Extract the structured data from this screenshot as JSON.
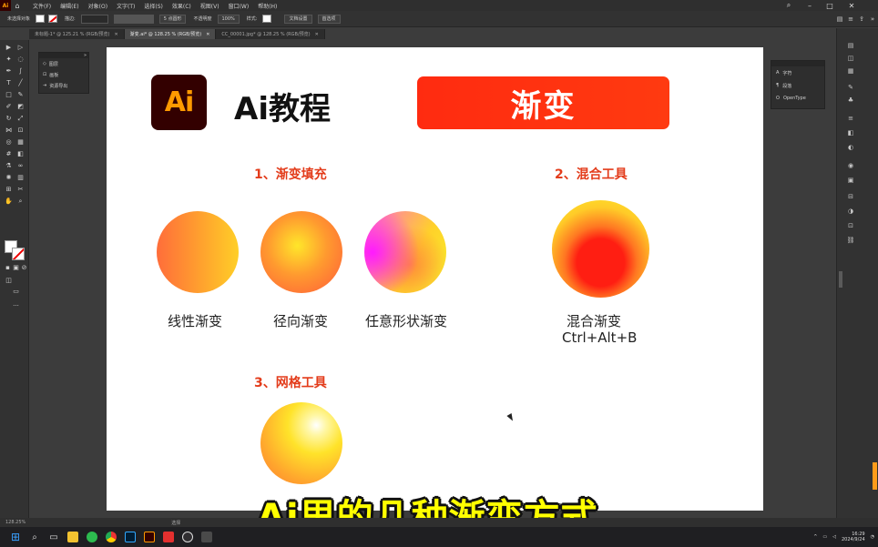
{
  "app": {
    "logo": "Ai",
    "menu": [
      "文件(F)",
      "编辑(E)",
      "对象(O)",
      "文字(T)",
      "选择(S)",
      "效果(C)",
      "视图(V)",
      "窗口(W)",
      "帮助(H)"
    ]
  },
  "control_bar": {
    "selection_label": "未选择对象",
    "stroke_label": "描边:",
    "brush_label": "5 点圆形",
    "opacity_label": "不透明度",
    "opacity_value": "100%",
    "style_label": "样式:",
    "doc_setup_button": "文档设置",
    "preferences_button": "首选项"
  },
  "tabs": [
    {
      "label": "未标题-1* @ 125.21 % (RGB/预览)",
      "active": false
    },
    {
      "label": "渐变.ai* @ 128.25 % (RGB/预览)",
      "active": true
    },
    {
      "label": "CC_00001.jpg* @ 128.25 % (RGB/预览)",
      "active": false
    }
  ],
  "layers_panel": {
    "rows": [
      "图层",
      "画板",
      "资源导出"
    ]
  },
  "char_panel": {
    "rows": [
      "字符",
      "段落",
      "OpenType"
    ]
  },
  "artboard": {
    "logo_text": "Ai",
    "heading": "Ai教程",
    "banner": "渐变",
    "sections": {
      "gradient_fill": "1、渐变填充",
      "blend_tool": "2、混合工具",
      "mesh_tool": "3、网格工具"
    },
    "captions": {
      "linear": "线性渐变",
      "radial": "径向渐变",
      "freeform": "任意形状渐变",
      "blend": "混合渐变",
      "blend_shortcut": "Ctrl+Alt+B"
    }
  },
  "subtitle": "Ai里的几种渐变方式",
  "status_bar": {
    "zoom": "128.25%",
    "tool": "选择"
  },
  "taskbar": {
    "time": "16:29",
    "date": "2024/9/24"
  },
  "colors": {
    "accent_red": "#ff2b10",
    "section_red": "#e33c1b",
    "ai_orange": "#ff9a00",
    "ai_dark": "#330000",
    "subtitle_yellow": "#ffff00"
  }
}
